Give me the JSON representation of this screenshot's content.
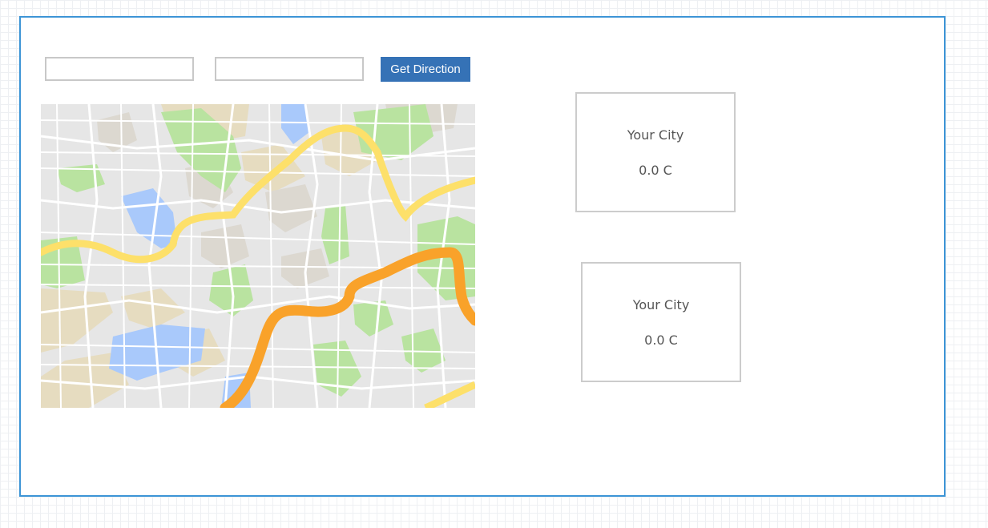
{
  "directions": {
    "origin_value": "",
    "origin_placeholder": "",
    "destination_value": "",
    "destination_placeholder": "",
    "button_label": "Get Direction"
  },
  "weather_cards": [
    {
      "city": "Your City",
      "temperature": "0.0 C"
    },
    {
      "city": "Your City",
      "temperature": "0.0 C"
    }
  ],
  "colors": {
    "frame_border": "#3d95d6",
    "button": "#3572b6",
    "map_block": "#e6e6e6",
    "map_park": "#b9e3a0",
    "map_water": "#a9c9fb",
    "map_sand": "#e6dcc0",
    "map_dark_block": "#dcd8d0",
    "route_major": "#f9a22a",
    "route_minor": "#fde06a"
  },
  "icons": [
    "map-image"
  ]
}
